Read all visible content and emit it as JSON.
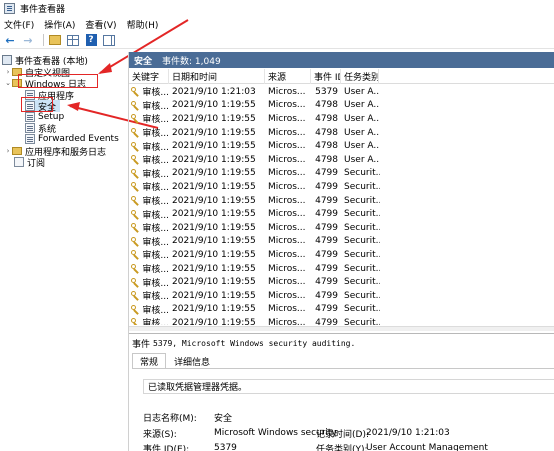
{
  "window": {
    "title": "事件查看器"
  },
  "menu": [
    "文件(F)",
    "操作(A)",
    "查看(V)",
    "帮助(H)"
  ],
  "tree": {
    "root": "事件查看器 (本地)",
    "custom_views": "自定义视图",
    "windows_logs": "Windows 日志",
    "logs": [
      "应用程序",
      "安全",
      "Setup",
      "系统",
      "Forwarded Events"
    ],
    "apps_services": "应用程序和服务日志",
    "subscriptions": "订阅"
  },
  "pane": {
    "name": "安全",
    "count_label": "事件数: 1,049"
  },
  "columns": [
    "关键字",
    "日期和时间",
    "来源",
    "事件 ID",
    "任务类别"
  ],
  "events": [
    {
      "keyword": "审核...",
      "datetime": "2021/9/10 1:21:03",
      "source": "Micros...",
      "id": "5379",
      "task": "User A..."
    },
    {
      "keyword": "审核...",
      "datetime": "2021/9/10 1:19:55",
      "source": "Micros...",
      "id": "4798",
      "task": "User A..."
    },
    {
      "keyword": "审核...",
      "datetime": "2021/9/10 1:19:55",
      "source": "Micros...",
      "id": "4798",
      "task": "User A..."
    },
    {
      "keyword": "审核...",
      "datetime": "2021/9/10 1:19:55",
      "source": "Micros...",
      "id": "4798",
      "task": "User A..."
    },
    {
      "keyword": "审核...",
      "datetime": "2021/9/10 1:19:55",
      "source": "Micros...",
      "id": "4798",
      "task": "User A..."
    },
    {
      "keyword": "审核...",
      "datetime": "2021/9/10 1:19:55",
      "source": "Micros...",
      "id": "4798",
      "task": "User A..."
    },
    {
      "keyword": "审核...",
      "datetime": "2021/9/10 1:19:55",
      "source": "Micros...",
      "id": "4799",
      "task": "Securit..."
    },
    {
      "keyword": "审核...",
      "datetime": "2021/9/10 1:19:55",
      "source": "Micros...",
      "id": "4799",
      "task": "Securit..."
    },
    {
      "keyword": "审核...",
      "datetime": "2021/9/10 1:19:55",
      "source": "Micros...",
      "id": "4799",
      "task": "Securit..."
    },
    {
      "keyword": "审核...",
      "datetime": "2021/9/10 1:19:55",
      "source": "Micros...",
      "id": "4799",
      "task": "Securit..."
    },
    {
      "keyword": "审核...",
      "datetime": "2021/9/10 1:19:55",
      "source": "Micros...",
      "id": "4799",
      "task": "Securit..."
    },
    {
      "keyword": "审核...",
      "datetime": "2021/9/10 1:19:55",
      "source": "Micros...",
      "id": "4799",
      "task": "Securit..."
    },
    {
      "keyword": "审核...",
      "datetime": "2021/9/10 1:19:55",
      "source": "Micros...",
      "id": "4799",
      "task": "Securit..."
    },
    {
      "keyword": "审核...",
      "datetime": "2021/9/10 1:19:55",
      "source": "Micros...",
      "id": "4799",
      "task": "Securit..."
    },
    {
      "keyword": "审核...",
      "datetime": "2021/9/10 1:19:55",
      "source": "Micros...",
      "id": "4799",
      "task": "Securit..."
    },
    {
      "keyword": "审核...",
      "datetime": "2021/9/10 1:19:55",
      "source": "Micros...",
      "id": "4799",
      "task": "Securit..."
    },
    {
      "keyword": "审核...",
      "datetime": "2021/9/10 1:19:55",
      "source": "Micros...",
      "id": "4799",
      "task": "Securit..."
    },
    {
      "keyword": "审核...",
      "datetime": "2021/9/10 1:19:55",
      "source": "Micros...",
      "id": "4799",
      "task": "Securit..."
    },
    {
      "keyword": "审核...",
      "datetime": "2021/9/10 1:19:55",
      "source": "Micros...",
      "id": "4799",
      "task": "Securit..."
    }
  ],
  "detail": {
    "title_prefix": "事件",
    "title": "5379, Microsoft Windows security auditing.",
    "tabs": [
      "常规",
      "详细信息"
    ],
    "message": "已读取凭据管理器凭据。",
    "fields": {
      "log_name_label": "日志名称(M):",
      "log_name": "安全",
      "source_label": "来源(S):",
      "source": "Microsoft Windows security",
      "logged_label": "记录时间(D):",
      "logged": "2021/9/10 1:21:03",
      "event_id_label": "事件 ID(E):",
      "event_id": "5379",
      "task_label": "任务类别(Y):",
      "task": "User Account Management"
    }
  },
  "colors": {
    "header_bg": "#4a6c96",
    "annotation_red": "#e32626",
    "selection": "#cce4f7"
  }
}
